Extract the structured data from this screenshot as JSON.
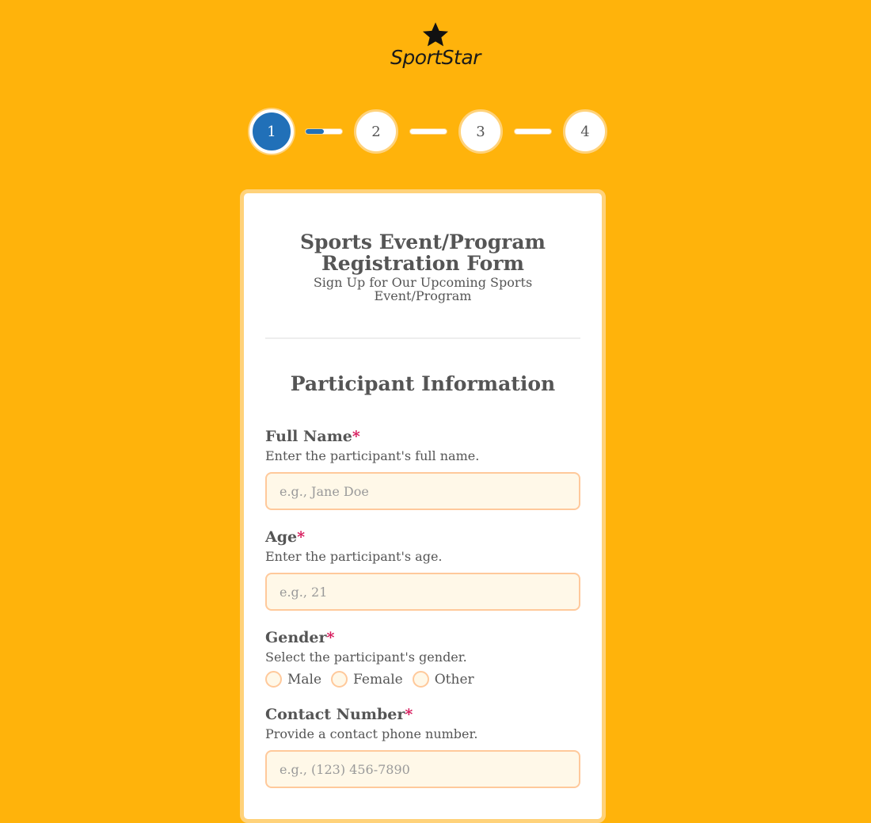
{
  "brand": {
    "name": "SportStar",
    "icon": "star-icon"
  },
  "steps": {
    "items": [
      {
        "label": "1",
        "active": true
      },
      {
        "label": "2",
        "active": false
      },
      {
        "label": "3",
        "active": false
      },
      {
        "label": "4",
        "active": false
      }
    ],
    "current": 1,
    "total": 4,
    "connector_progress": [
      0.5,
      0,
      0
    ]
  },
  "colors": {
    "background": "#FFB30B",
    "accent": "#2170B8",
    "required": "#D6175A",
    "input_border": "#FFC99B",
    "input_bg": "#FFF8E8"
  },
  "form": {
    "title": "Sports Event/Program Registration Form",
    "subtitle": "Sign Up for Our Upcoming Sports Event/Program",
    "section_title": "Participant Information",
    "fields": {
      "full_name": {
        "label": "Full Name",
        "required_mark": "*",
        "help": "Enter the participant's full name.",
        "placeholder": "e.g., Jane Doe",
        "value": ""
      },
      "age": {
        "label": "Age",
        "required_mark": "*",
        "help": "Enter the participant's age.",
        "placeholder": "e.g., 21",
        "value": ""
      },
      "gender": {
        "label": "Gender",
        "required_mark": "*",
        "help": "Select the participant's gender.",
        "options": [
          "Male",
          "Female",
          "Other"
        ],
        "selected": null
      },
      "contact_number": {
        "label": "Contact Number",
        "required_mark": "*",
        "help": "Provide a contact phone number.",
        "placeholder": "e.g., (123) 456-7890",
        "value": ""
      }
    }
  }
}
